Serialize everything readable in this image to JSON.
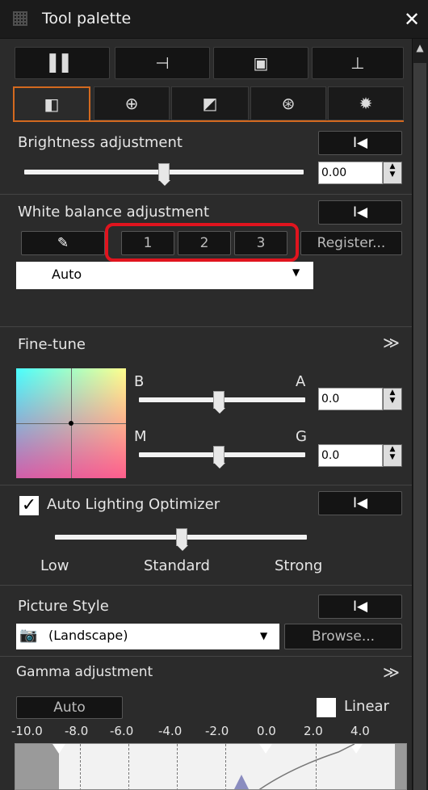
{
  "window": {
    "title": "Tool palette",
    "close_glyph": "✕"
  },
  "toolbar": {
    "buttons": [
      {
        "icon": "adjust-tool-icon",
        "glyph": "▌▌"
      },
      {
        "icon": "crop-tool-icon",
        "glyph": "⊣"
      },
      {
        "icon": "dust-delete-icon",
        "glyph": "▣"
      },
      {
        "icon": "stamp-tool-icon",
        "glyph": "⊥"
      }
    ]
  },
  "tabs": [
    {
      "icon": "basic-adjust-tab-icon",
      "glyph": "◧",
      "active": true
    },
    {
      "icon": "detail-tab-icon",
      "glyph": "⊕",
      "active": false
    },
    {
      "icon": "tone-curve-tab-icon",
      "glyph": "◩",
      "active": false
    },
    {
      "icon": "color-tab-icon",
      "glyph": "⊛",
      "active": false
    },
    {
      "icon": "settings-tab-icon",
      "glyph": "✹",
      "active": false
    }
  ],
  "brightness": {
    "label": "Brightness adjustment",
    "reset_glyph": "I◀",
    "value": "0.00",
    "level": 0.5
  },
  "white_balance": {
    "label": "White balance adjustment",
    "reset_glyph": "I◀",
    "presets": [
      "1",
      "2",
      "3"
    ],
    "register_label": "Register...",
    "selected": "Auto",
    "highlight_color": "#e0141e"
  },
  "fine_tune": {
    "label": "Fine-tune",
    "collapse_glyph": "≫",
    "b_label": "B",
    "a_label": "A",
    "ba_value": "0.0",
    "m_label": "M",
    "g_label": "G",
    "mg_value": "0.0"
  },
  "auto_lighting": {
    "label": "Auto Lighting Optimizer",
    "checked": true,
    "reset_glyph": "I◀",
    "levels": [
      "Low",
      "Standard",
      "Strong"
    ],
    "level": 0.5
  },
  "picture_style": {
    "label": "Picture Style",
    "reset_glyph": "I◀",
    "selected": "(Landscape)",
    "browse_label": "Browse..."
  },
  "gamma": {
    "label": "Gamma adjustment",
    "collapse_glyph": "≫",
    "auto_label": "Auto",
    "linear_label": "Linear",
    "scale": [
      "-10.0",
      "-8.0",
      "-6.0",
      "-4.0",
      "-2.0",
      "0.0",
      "2.0",
      "4.0"
    ]
  },
  "colors": {
    "accent": "#d3691f",
    "background": "#2b2b2b"
  }
}
